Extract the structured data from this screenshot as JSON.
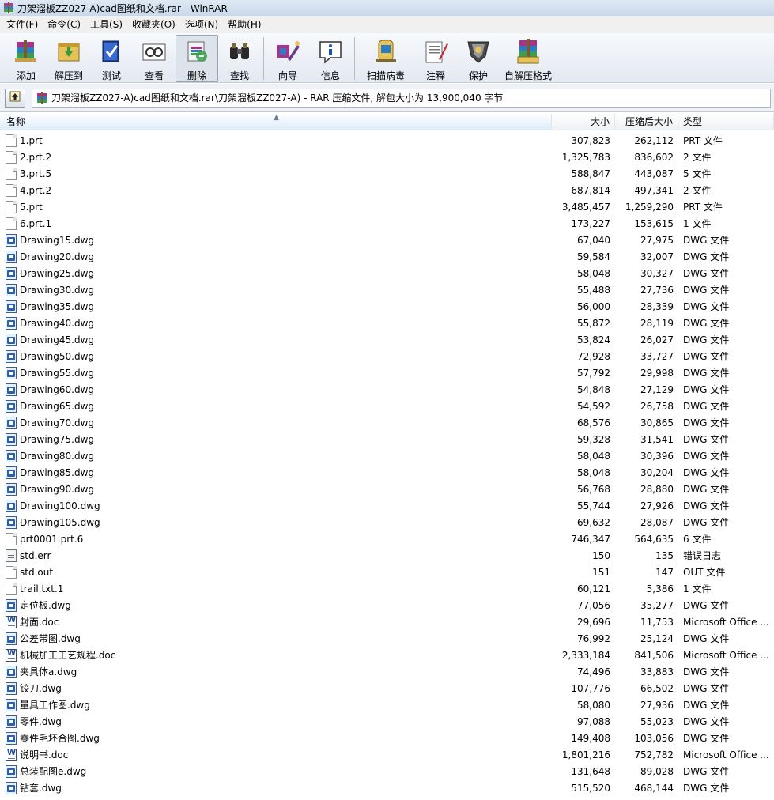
{
  "window": {
    "title": "刀架溜板ZZ027-A)cad图纸和文档.rar - WinRAR"
  },
  "menu": [
    "文件(F)",
    "命令(C)",
    "工具(S)",
    "收藏夹(O)",
    "选项(N)",
    "帮助(H)"
  ],
  "toolbar": [
    {
      "label": "添加",
      "icon": "add-archive-icon"
    },
    {
      "label": "解压到",
      "icon": "extract-to-icon"
    },
    {
      "label": "测试",
      "icon": "test-icon"
    },
    {
      "label": "查看",
      "icon": "view-icon"
    },
    {
      "label": "删除",
      "icon": "delete-icon",
      "pressed": true
    },
    {
      "label": "查找",
      "icon": "find-icon"
    },
    {
      "label": "向导",
      "icon": "wizard-icon"
    },
    {
      "label": "信息",
      "icon": "info-icon"
    },
    {
      "label": "扫描病毒",
      "icon": "scan-virus-icon"
    },
    {
      "label": "注释",
      "icon": "comment-icon"
    },
    {
      "label": "保护",
      "icon": "protect-icon"
    },
    {
      "label": "自解压格式",
      "icon": "sfx-icon"
    }
  ],
  "address": {
    "path": "刀架溜板ZZ027-A)cad图纸和文档.rar\\刀架溜板ZZ027-A) - RAR 压缩文件, 解包大小为 13,900,040 字节"
  },
  "columns": {
    "name": "名称",
    "size": "大小",
    "packed": "压缩后大小",
    "type": "类型"
  },
  "files": [
    {
      "name": "1.prt",
      "size": "307,823",
      "packed": "262,112",
      "type": "PRT 文件",
      "kind": "blank"
    },
    {
      "name": "2.prt.2",
      "size": "1,325,783",
      "packed": "836,602",
      "type": "2 文件",
      "kind": "blank"
    },
    {
      "name": "3.prt.5",
      "size": "588,847",
      "packed": "443,087",
      "type": "5 文件",
      "kind": "blank"
    },
    {
      "name": "4.prt.2",
      "size": "687,814",
      "packed": "497,341",
      "type": "2 文件",
      "kind": "blank"
    },
    {
      "name": "5.prt",
      "size": "3,485,457",
      "packed": "1,259,290",
      "type": "PRT 文件",
      "kind": "blank"
    },
    {
      "name": "6.prt.1",
      "size": "173,227",
      "packed": "153,615",
      "type": "1 文件",
      "kind": "blank"
    },
    {
      "name": "Drawing15.dwg",
      "size": "67,040",
      "packed": "27,975",
      "type": "DWG 文件",
      "kind": "dwg"
    },
    {
      "name": "Drawing20.dwg",
      "size": "59,584",
      "packed": "32,007",
      "type": "DWG 文件",
      "kind": "dwg"
    },
    {
      "name": "Drawing25.dwg",
      "size": "58,048",
      "packed": "30,327",
      "type": "DWG 文件",
      "kind": "dwg"
    },
    {
      "name": "Drawing30.dwg",
      "size": "55,488",
      "packed": "27,736",
      "type": "DWG 文件",
      "kind": "dwg"
    },
    {
      "name": "Drawing35.dwg",
      "size": "56,000",
      "packed": "28,339",
      "type": "DWG 文件",
      "kind": "dwg"
    },
    {
      "name": "Drawing40.dwg",
      "size": "55,872",
      "packed": "28,119",
      "type": "DWG 文件",
      "kind": "dwg"
    },
    {
      "name": "Drawing45.dwg",
      "size": "53,824",
      "packed": "26,027",
      "type": "DWG 文件",
      "kind": "dwg"
    },
    {
      "name": "Drawing50.dwg",
      "size": "72,928",
      "packed": "33,727",
      "type": "DWG 文件",
      "kind": "dwg"
    },
    {
      "name": "Drawing55.dwg",
      "size": "57,792",
      "packed": "29,998",
      "type": "DWG 文件",
      "kind": "dwg"
    },
    {
      "name": "Drawing60.dwg",
      "size": "54,848",
      "packed": "27,129",
      "type": "DWG 文件",
      "kind": "dwg"
    },
    {
      "name": "Drawing65.dwg",
      "size": "54,592",
      "packed": "26,758",
      "type": "DWG 文件",
      "kind": "dwg"
    },
    {
      "name": "Drawing70.dwg",
      "size": "68,576",
      "packed": "30,865",
      "type": "DWG 文件",
      "kind": "dwg"
    },
    {
      "name": "Drawing75.dwg",
      "size": "59,328",
      "packed": "31,541",
      "type": "DWG 文件",
      "kind": "dwg"
    },
    {
      "name": "Drawing80.dwg",
      "size": "58,048",
      "packed": "30,396",
      "type": "DWG 文件",
      "kind": "dwg"
    },
    {
      "name": "Drawing85.dwg",
      "size": "58,048",
      "packed": "30,204",
      "type": "DWG 文件",
      "kind": "dwg"
    },
    {
      "name": "Drawing90.dwg",
      "size": "56,768",
      "packed": "28,880",
      "type": "DWG 文件",
      "kind": "dwg"
    },
    {
      "name": "Drawing100.dwg",
      "size": "55,744",
      "packed": "27,926",
      "type": "DWG 文件",
      "kind": "dwg"
    },
    {
      "name": "Drawing105.dwg",
      "size": "69,632",
      "packed": "28,087",
      "type": "DWG 文件",
      "kind": "dwg"
    },
    {
      "name": "prt0001.prt.6",
      "size": "746,347",
      "packed": "564,635",
      "type": "6 文件",
      "kind": "blank"
    },
    {
      "name": "std.err",
      "size": "150",
      "packed": "135",
      "type": "错误日志",
      "kind": "err"
    },
    {
      "name": "std.out",
      "size": "151",
      "packed": "147",
      "type": "OUT 文件",
      "kind": "blank"
    },
    {
      "name": "trail.txt.1",
      "size": "60,121",
      "packed": "5,386",
      "type": "1 文件",
      "kind": "blank"
    },
    {
      "name": "定位板.dwg",
      "size": "77,056",
      "packed": "35,277",
      "type": "DWG 文件",
      "kind": "dwg"
    },
    {
      "name": "封面.doc",
      "size": "29,696",
      "packed": "11,753",
      "type": "Microsoft Office ...",
      "kind": "doc"
    },
    {
      "name": "公差带图.dwg",
      "size": "76,992",
      "packed": "25,124",
      "type": "DWG 文件",
      "kind": "dwg"
    },
    {
      "name": "机械加工工艺规程.doc",
      "size": "2,333,184",
      "packed": "841,506",
      "type": "Microsoft Office ...",
      "kind": "doc"
    },
    {
      "name": "夹具体a.dwg",
      "size": "74,496",
      "packed": "33,883",
      "type": "DWG 文件",
      "kind": "dwg"
    },
    {
      "name": "铰刀.dwg",
      "size": "107,776",
      "packed": "66,502",
      "type": "DWG 文件",
      "kind": "dwg"
    },
    {
      "name": "量具工作图.dwg",
      "size": "58,080",
      "packed": "27,936",
      "type": "DWG 文件",
      "kind": "dwg"
    },
    {
      "name": "零件.dwg",
      "size": "97,088",
      "packed": "55,023",
      "type": "DWG 文件",
      "kind": "dwg"
    },
    {
      "name": "零件毛坯合图.dwg",
      "size": "149,408",
      "packed": "103,056",
      "type": "DWG 文件",
      "kind": "dwg"
    },
    {
      "name": "说明书.doc",
      "size": "1,801,216",
      "packed": "752,782",
      "type": "Microsoft Office ...",
      "kind": "doc"
    },
    {
      "name": "总装配图e.dwg",
      "size": "131,648",
      "packed": "89,028",
      "type": "DWG 文件",
      "kind": "dwg"
    },
    {
      "name": "钻套.dwg",
      "size": "515,520",
      "packed": "468,144",
      "type": "DWG 文件",
      "kind": "dwg"
    }
  ]
}
